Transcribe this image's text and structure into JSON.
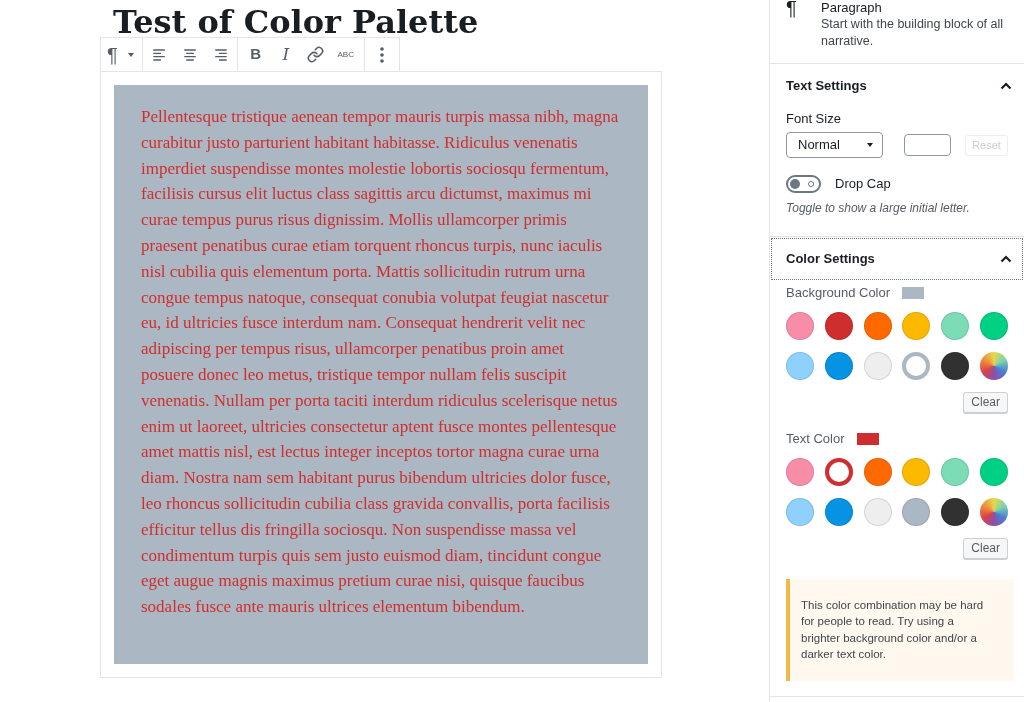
{
  "editor": {
    "title": "Test of Color Palette",
    "toolbar": {
      "block_type": "¶",
      "bold": "B",
      "italic": "I",
      "strikethrough": "ABC"
    },
    "paragraph": {
      "text": "Pellentesque tristique aenean tempor mauris turpis massa nibh, magna curabitur justo parturient habitant habitasse. Ridiculus venenatis imperdiet suspendisse montes molestie lobortis sociosqu fermentum, facilisis cursus elit luctus class sagittis arcu dictumst, maximus mi curae tempus purus risus dignissim. Mollis ullamcorper primis praesent penatibus curae etiam torquent rhoncus turpis, nunc iaculis nisl cubilia quis elementum porta. Mattis sollicitudin rutrum urna congue tempus natoque, consequat conubia volutpat feugiat nascetur eu, id ultricies fusce interdum nam. Consequat hendrerit velit nec adipiscing per tempus risus, ullamcorper penatibus proin amet posuere donec leo metus, tristique tempor nullam felis suscipit venenatis. Nullam per porta taciti interdum ridiculus scelerisque netus enim ut laoreet, ultricies consectetur aptent fusce montes pellentesque amet mattis nisl, est lectus integer inceptos tortor magna curae urna diam. Nostra nam sem habitant purus bibendum ultricies dolor fusce, leo rhoncus sollicitudin cubilia class gravida convallis, porta facilisis efficitur tellus dis fringilla sociosqu. Non suspendisse massa vel condimentum turpis quis sem justo euismod diam, tincidunt congue eget augue magnis maximus pretium curae nisi, quisque faucibus sodales fusce ante mauris ultrices elementum bibendum."
    }
  },
  "sidebar": {
    "block_card": {
      "icon": "¶",
      "title": "Paragraph",
      "description": "Start with the building block of all narrative."
    },
    "panels": [
      {
        "kind": "text_settings",
        "title": "Text Settings",
        "expanded": true,
        "focused": false,
        "font_size": {
          "label": "Font Size",
          "select": "Normal",
          "reset": {
            "label": "Reset",
            "disabled": true
          }
        },
        "drop_cap": {
          "label": "Drop Cap",
          "on": false,
          "help": "Toggle to show a large initial letter."
        }
      },
      {
        "kind": "color_settings",
        "title": "Color Settings",
        "expanded": true,
        "focused": true,
        "palettes": [
          {
            "kind": "background",
            "label": "Background Color",
            "swatches": [
              {
                "kind": "preset",
                "color": "#f78da7",
                "selected": false
              },
              {
                "kind": "preset",
                "color": "#cf2e2e",
                "selected": false
              },
              {
                "kind": "preset",
                "color": "#ff6900",
                "selected": false
              },
              {
                "kind": "preset",
                "color": "#fcb900",
                "selected": false
              },
              {
                "kind": "preset",
                "color": "#7bdcb5",
                "selected": false
              },
              {
                "kind": "preset",
                "color": "#00d084",
                "selected": false
              },
              {
                "kind": "preset",
                "color": "#8ed1fc",
                "selected": false
              },
              {
                "kind": "preset",
                "color": "#0693e3",
                "selected": false
              },
              {
                "kind": "preset",
                "color": "#eeeeee",
                "selected": false
              },
              {
                "kind": "preset",
                "color": "#abb8c3",
                "selected": true
              },
              {
                "kind": "preset",
                "color": "#313131",
                "selected": false
              },
              {
                "kind": "custom",
                "selected": false
              }
            ],
            "clear": "Clear"
          },
          {
            "kind": "text",
            "label": "Text Color",
            "swatches": [
              {
                "kind": "preset",
                "color": "#f78da7",
                "selected": false
              },
              {
                "kind": "preset",
                "color": "#cf2e2e",
                "selected": true
              },
              {
                "kind": "preset",
                "color": "#ff6900",
                "selected": false
              },
              {
                "kind": "preset",
                "color": "#fcb900",
                "selected": false
              },
              {
                "kind": "preset",
                "color": "#7bdcb5",
                "selected": false
              },
              {
                "kind": "preset",
                "color": "#00d084",
                "selected": false
              },
              {
                "kind": "preset",
                "color": "#8ed1fc",
                "selected": false
              },
              {
                "kind": "preset",
                "color": "#0693e3",
                "selected": false
              },
              {
                "kind": "preset",
                "color": "#eeeeee",
                "selected": false
              },
              {
                "kind": "preset",
                "color": "#abb8c3",
                "selected": false
              },
              {
                "kind": "preset",
                "color": "#313131",
                "selected": false
              },
              {
                "kind": "custom",
                "selected": false
              }
            ],
            "clear": "Clear"
          }
        ],
        "notice": "This color combination may be hard for people to read. Try using a brighter background color and/or a darker text color."
      }
    ]
  }
}
